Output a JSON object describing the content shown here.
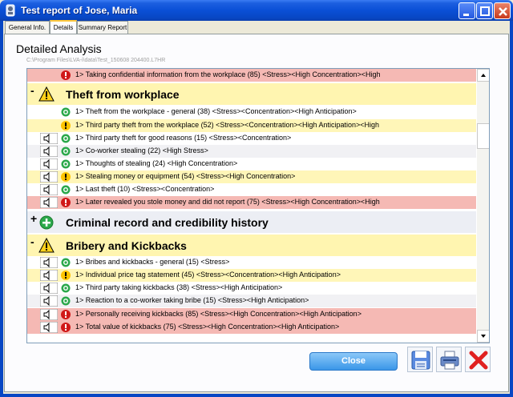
{
  "window": {
    "title": "Test report of Jose, Maria"
  },
  "tabs": [
    {
      "label": "General Info."
    },
    {
      "label": "Details"
    },
    {
      "label": "Summary Report"
    }
  ],
  "panel": {
    "title": "Detailed Analysis",
    "path": "C:\\Program Files\\LVA-i\\data\\Test_150608 204400.L7HR"
  },
  "list": {
    "rows": [
      {
        "text": "1> Taking confidential information from the workplace (85) <Stress><High Concentration><High"
      },
      {
        "text": "Theft from workplace",
        "sign": "-"
      },
      {
        "text": "1> Theft from the workplace - general (38) <Stress><Concentration><High Anticipation>"
      },
      {
        "text": "1> Third party theft from the workplace (52) <Stress><Concentration><High Anticipation><High"
      },
      {
        "text": "1> Third party theft for good reasons (15) <Stress><Concentration>"
      },
      {
        "text": "1> Co-worker stealing (22) <High Stress>"
      },
      {
        "text": "1> Thoughts of stealing (24) <High Concentration>"
      },
      {
        "text": "1> Stealing money or equipment (54) <Stress><High Concentration>"
      },
      {
        "text": "1> Last theft (10) <Stress><Concentration>"
      },
      {
        "text": "1> Later revealed you stole money and did not report (75) <Stress><High Concentration><High"
      },
      {
        "text": "Criminal record and credibility history",
        "sign": "+"
      },
      {
        "text": "Bribery and Kickbacks",
        "sign": "-"
      },
      {
        "text": "1> Bribes and kickbacks - general (15) <Stress>"
      },
      {
        "text": "1> Individual price tag statement (45) <Stress><Concentration><High Anticipation>"
      },
      {
        "text": "1> Third party taking kickbacks (38) <Stress><High Anticipation>"
      },
      {
        "text": "1> Reaction to a co-worker taking bribe (15) <Stress><High Anticipation>"
      },
      {
        "text": "1> Personally receiving kickbacks (85) <Stress><High Concentration><High Anticipation>"
      },
      {
        "text": "1> Total value of kickbacks (75) <Stress><High Concentration><High Anticipation>"
      }
    ]
  },
  "buttons": {
    "close": "Close"
  },
  "colors": {
    "red_row": "#f5b9b4",
    "yellow_row": "#fff6b8",
    "accent": "#0a4fd6"
  }
}
